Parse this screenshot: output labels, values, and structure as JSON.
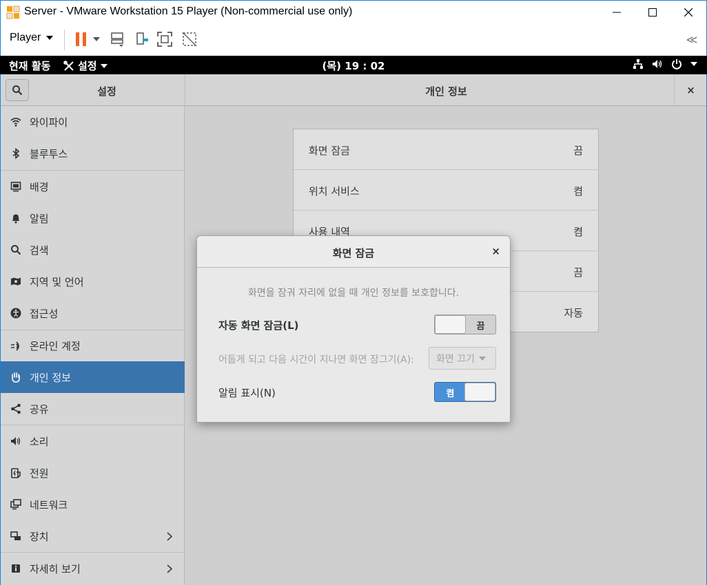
{
  "window": {
    "title": "Server - VMware Workstation 15 Player (Non-commercial use only)",
    "minimize_icon": "minimize-icon",
    "maximize_icon": "maximize-icon",
    "close_icon": "close-icon"
  },
  "toolbar": {
    "player_label": "Player",
    "collapse_label": "≪"
  },
  "gnome_bar": {
    "activities": "현재 활동",
    "app_menu": "설정",
    "clock": "(목) 19 : 02"
  },
  "header": {
    "sidebar_title": "설정",
    "panel_title": "개인 정보",
    "close_label": "×"
  },
  "sidebar": {
    "items": [
      {
        "label": "와이파이",
        "icon": "wifi-icon"
      },
      {
        "label": "블루투스",
        "icon": "bluetooth-icon"
      },
      {
        "label": "배경",
        "icon": "background-icon"
      },
      {
        "label": "알림",
        "icon": "bell-icon"
      },
      {
        "label": "검색",
        "icon": "search-icon"
      },
      {
        "label": "지역 및 언어",
        "icon": "region-icon"
      },
      {
        "label": "접근성",
        "icon": "accessibility-icon"
      },
      {
        "label": "온라인 계정",
        "icon": "online-accounts-icon"
      },
      {
        "label": "개인 정보",
        "icon": "privacy-hand-icon"
      },
      {
        "label": "공유",
        "icon": "share-icon"
      },
      {
        "label": "소리",
        "icon": "sound-icon"
      },
      {
        "label": "전원",
        "icon": "power-icon"
      },
      {
        "label": "네트워크",
        "icon": "network-icon"
      },
      {
        "label": "장치",
        "icon": "devices-icon"
      },
      {
        "label": "자세히 보기",
        "icon": "info-icon"
      }
    ],
    "chevron": "›"
  },
  "privacy": {
    "rows": [
      {
        "label": "화면 잠금",
        "value": "끔"
      },
      {
        "label": "위치 서비스",
        "value": "켬"
      },
      {
        "label": "사용 내역",
        "value": "켬"
      },
      {
        "label": "",
        "value": "끔"
      },
      {
        "label": "",
        "value": "자동"
      }
    ]
  },
  "dialog": {
    "title": "화면 잠금",
    "close_label": "×",
    "description": "화면을 잠궈 자리에 없을 때 개인 정보를 보호합니다.",
    "auto_lock_label": "자동 화면 잠금(L)",
    "auto_lock_state": "끔",
    "delay_label": "어둡게 되고 다음 시간이 지나면 화면 잠그기(A):",
    "delay_value": "화면 끄기",
    "notifications_label": "알림 표시(N)",
    "notifications_state": "켬"
  },
  "colors": {
    "accent_selected": "#3974ad",
    "switch_on": "#4a90d9",
    "pause_icon": "#f26522"
  }
}
